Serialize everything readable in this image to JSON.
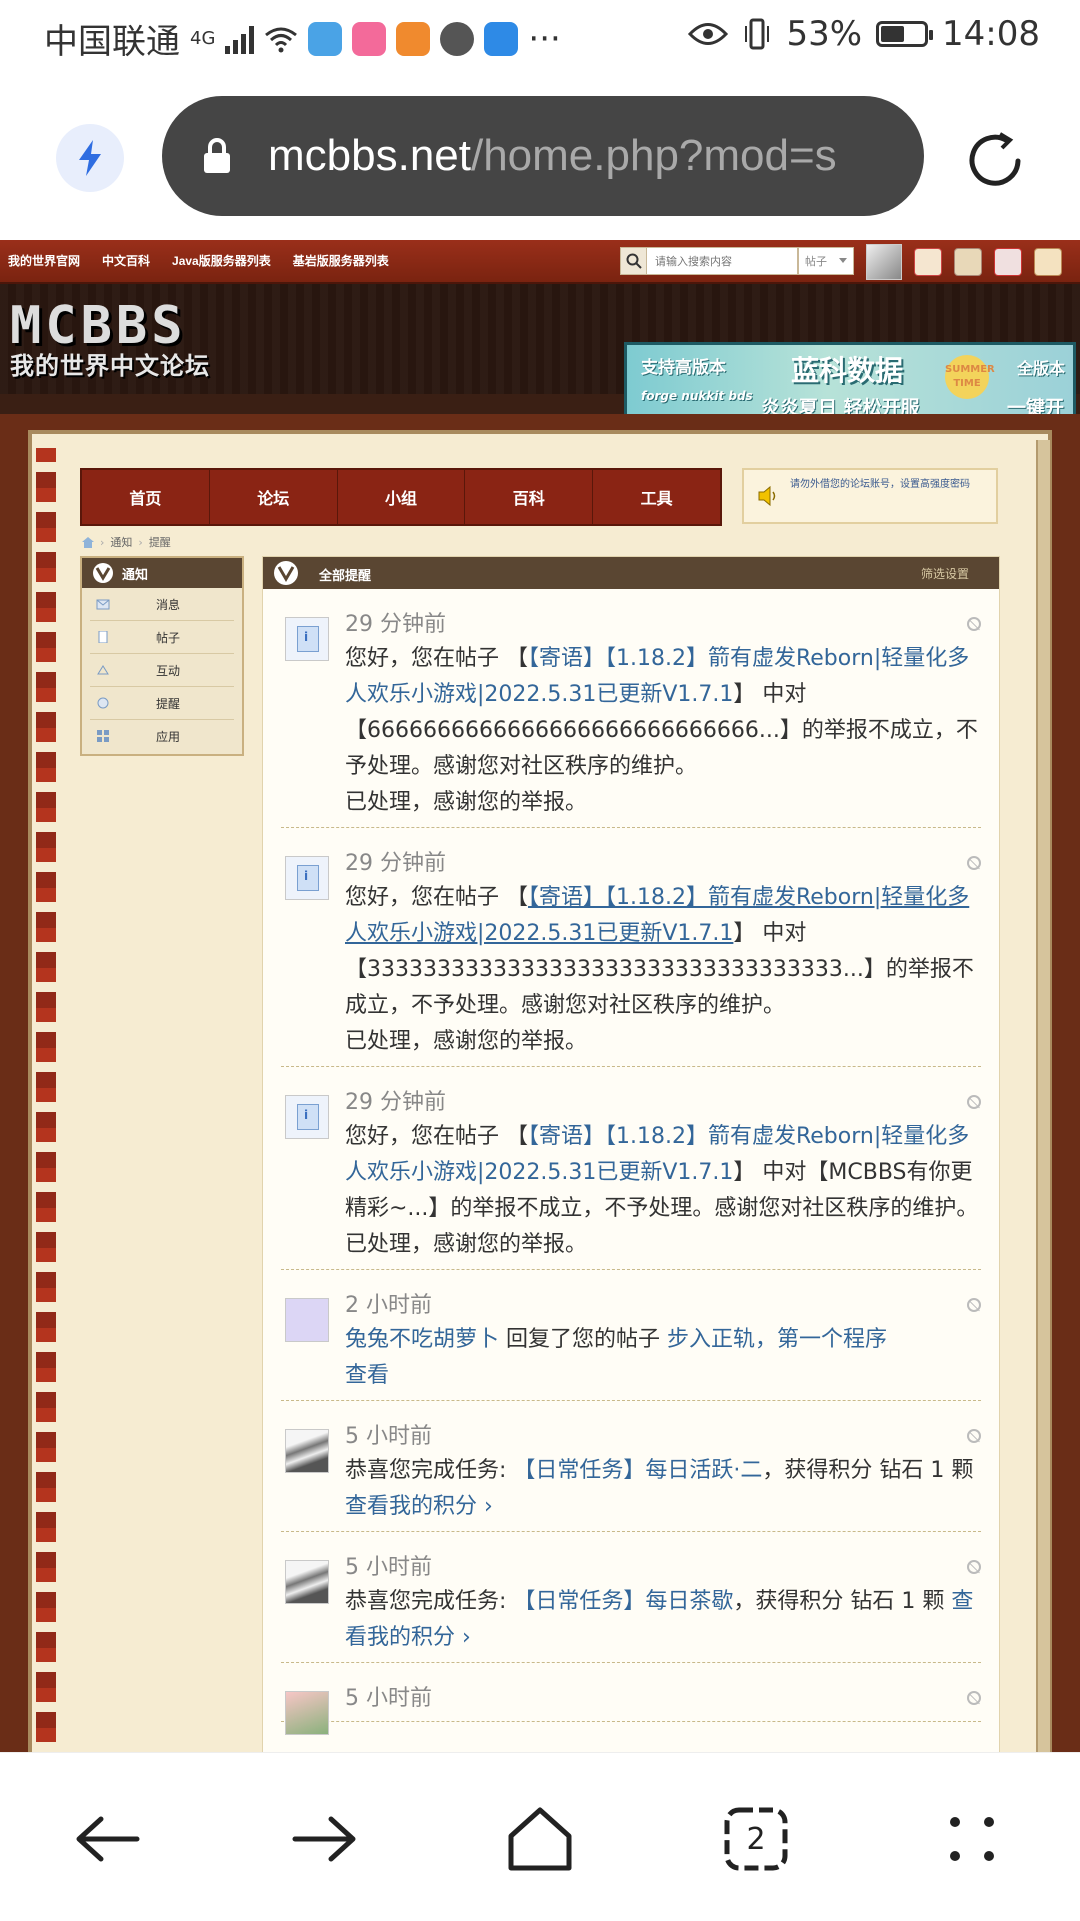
{
  "status_bar": {
    "carrier": "中国联通",
    "network": "4G",
    "battery": "53%",
    "battery_level": 0.53,
    "time": "14:08",
    "more": "···"
  },
  "browser": {
    "url_domain": "mcbbs.net",
    "url_path": "/home.php?mod=s"
  },
  "forum": {
    "top_links": [
      "我的世界官网",
      "中文百科",
      "Java版服务器列表",
      "基岩版服务器列表"
    ],
    "search_placeholder": "请输入搜索内容",
    "search_type": "帖子",
    "logo_main": "MCBBS",
    "logo_sub": "我的世界中文论坛",
    "banner": {
      "t1": "支持高版本",
      "t2": "forge nukkit bds",
      "t3": "蓝科数据",
      "t4": "炎炎夏日 轻松开服",
      "t5": "全版本",
      "t6": "一键开服",
      "sun": "SUMMER TIME"
    },
    "nav": [
      "首页",
      "论坛",
      "小组",
      "百科",
      "工具"
    ],
    "notice": "请勿外借您的论坛账号，设置高强度密码",
    "breadcrumb": [
      "通知",
      "提醒"
    ],
    "sidebar": {
      "title": "通知",
      "items": [
        "消息",
        "帖子",
        "互动",
        "提醒",
        "应用"
      ]
    },
    "content_title": "全部提醒",
    "filter_label": "筛选设置",
    "notes": [
      {
        "time": "29 分钟前",
        "pre": "您好，您在帖子 【",
        "link": "【寄语】【1.18.2】箭有虚发Reborn|轻量化多人欢乐小游戏|2022.5.31已更新V1.7.1",
        "post": "】 中对【6666666666666666666666666666...】的举报不成立，不予处理。感谢您对社区秩序的维护。",
        "line2": "已处理，感谢您的举报。"
      },
      {
        "time": "29 分钟前",
        "pre": "您好，您在帖子 【",
        "link": "【寄语】【1.18.2】箭有虚发Reborn|轻量化多人欢乐小游戏|2022.5.31已更新V1.7.1",
        "post": "】 中对【3333333333333333333333333333333333...】的举报不成立，不予处理。感谢您对社区秩序的维护。",
        "line2": "已处理，感谢您的举报。"
      },
      {
        "time": "29 分钟前",
        "pre": "您好，您在帖子 【",
        "link": "【寄语】【1.18.2】箭有虚发Reborn|轻量化多人欢乐小游戏|2022.5.31已更新V1.7.1",
        "post": "】 中对【MCBBS有你更精彩~...】的举报不成立，不予处理。感谢您对社区秩序的维护。",
        "line2": "已处理，感谢您的举报。"
      },
      {
        "time": "2 小时前",
        "user": "兔兔不吃胡萝卜",
        "mid": " 回复了您的帖子 ",
        "link": "步入正轨，第一个程序",
        "link2": "查看"
      },
      {
        "time": "5 小时前",
        "pre": "恭喜您完成任务: ",
        "link": "【日常任务】每日活跃·二",
        "post": "，获得积分 钻石 1 颗 ",
        "link2": "查看我的积分 ›"
      },
      {
        "time": "5 小时前",
        "pre": "恭喜您完成任务: ",
        "link": "【日常任务】每日茶歇",
        "post": "，获得积分 钻石 1 颗 ",
        "link2": "查看我的积分 ›"
      },
      {
        "time": "5 小时前"
      }
    ]
  },
  "bottom_nav": {
    "tabs_count": "2"
  }
}
